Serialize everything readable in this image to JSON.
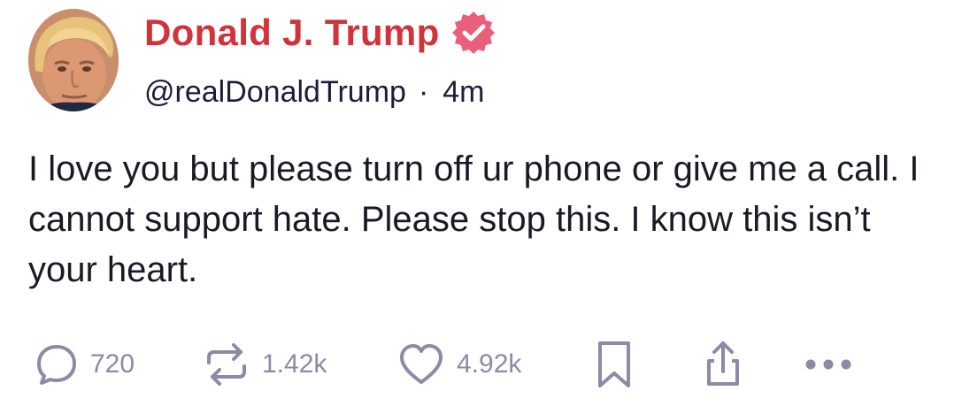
{
  "post": {
    "author": {
      "display_name": "Donald J. Trump",
      "handle": "@realDonaldTrump",
      "timestamp": "4m",
      "meta_separator": "·",
      "verified_badge_icon": "verified-badge-icon",
      "avatar": "profile-photo"
    },
    "text": "I love you but please turn off ur phone or give me a call. I cannot support hate. Please stop this. I know this isn’t your heart.",
    "actions": {
      "reply": {
        "icon": "comment-bubble-icon",
        "count": "720"
      },
      "repost": {
        "icon": "repost-arrows-icon",
        "count": "1.42k"
      },
      "like": {
        "icon": "heart-icon",
        "count": "4.92k"
      },
      "bookmark": {
        "icon": "bookmark-icon"
      },
      "share": {
        "icon": "share-upload-icon"
      },
      "more": {
        "icon": "more-dots-icon"
      }
    },
    "colors": {
      "name_red": "#d2333a",
      "verified_pink": "#e8607a",
      "action_gray": "#8c8aa6",
      "text_dark": "#1a1a24"
    }
  }
}
